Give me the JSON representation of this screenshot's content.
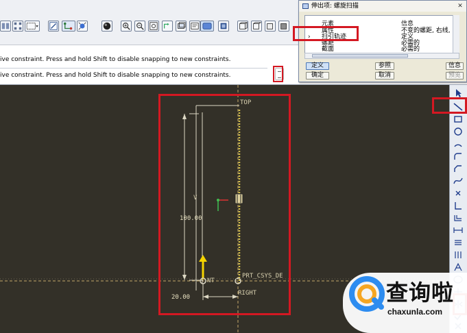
{
  "messages": {
    "line1": "ive constraint. Press and hold Shift to disable snapping to new constraints.",
    "line2": "ive constraint. Press and hold Shift to disable snapping to new constraints."
  },
  "toolbar": {
    "icons": [
      "feature-manager-icon",
      "datum-display-icon",
      "model-tree-icon",
      "sketch-tool-icon",
      "constraint-icon",
      "shading-icon",
      "zoom-in-icon",
      "zoom-out-icon",
      "refit-icon",
      "reorient-icon",
      "layer-icon",
      "saved-view-icon",
      "wireframe-icon",
      "hidden-line-icon",
      "no-hidden-icon",
      "shading-display-icon",
      "display-toggle-icon"
    ]
  },
  "canvas": {
    "labels": {
      "top": "TOP",
      "right": "RIGHT",
      "csys": "PRT_CSYS_DE",
      "v": "V",
      "start": "NT"
    },
    "dimensions": {
      "height": "100.00",
      "offset": "20.00"
    }
  },
  "palette": {
    "icons": [
      "select-arrow-icon",
      "line-icon",
      "rectangle-icon",
      "circle-icon",
      "arc-icon",
      "fillet-icon",
      "chamfer-icon",
      "spline-icon",
      "point-icon",
      "coordinate-system-icon",
      "use-edge-icon",
      "dimension-icon",
      "modify-icon",
      "constraint-icon",
      "text-icon",
      "palette-icon",
      "trim-icon",
      "mirror-icon",
      "done-icon",
      "quit-icon"
    ]
  },
  "dialog": {
    "title": "伸出项: 螺旋扫描",
    "close_glyph": "✕",
    "columns": {
      "element": "元素",
      "info": "信息"
    },
    "rows": [
      {
        "arrow": "",
        "element": "属性",
        "info": "不变的螺距, 右线, 穿"
      },
      {
        "arrow": "›",
        "element": "扫引轨迹",
        "info": "定义"
      },
      {
        "arrow": "",
        "element": "螺距",
        "info": "必需的"
      },
      {
        "arrow": "",
        "element": "截面",
        "info": "必需的"
      }
    ],
    "buttons": {
      "define": "定义",
      "reference": "参照",
      "info": "信息",
      "ok": "确定",
      "cancel": "取消",
      "preview": "预览"
    }
  },
  "watermark": {
    "chinese": "查询啦",
    "domain": "chaxunla.com"
  }
}
